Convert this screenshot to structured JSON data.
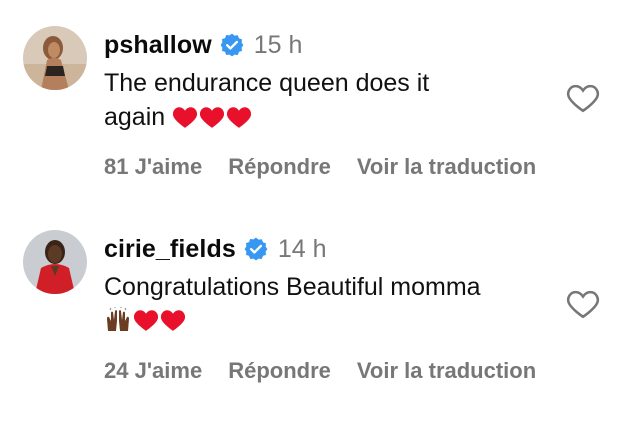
{
  "comments": [
    {
      "username": "pshallow",
      "time": "15 h",
      "text_line1": "The endurance queen does it",
      "text_line2": "again",
      "emoji": [
        "red-heart",
        "red-heart",
        "red-heart"
      ],
      "likes": "81 J'aime",
      "reply": "Répondre",
      "translate": "Voir la traduction"
    },
    {
      "username": "cirie_fields",
      "time": "14 h",
      "text_line1": "Congratulations Beautiful momma",
      "text_line2": "",
      "emoji": [
        "raising-hands-dark",
        "red-heart",
        "red-heart"
      ],
      "likes": "24 J'aime",
      "reply": "Répondre",
      "translate": "Voir la traduction"
    }
  ],
  "colors": {
    "verified": "#3897f0",
    "muted": "#777777",
    "heart": "#e8102a"
  }
}
